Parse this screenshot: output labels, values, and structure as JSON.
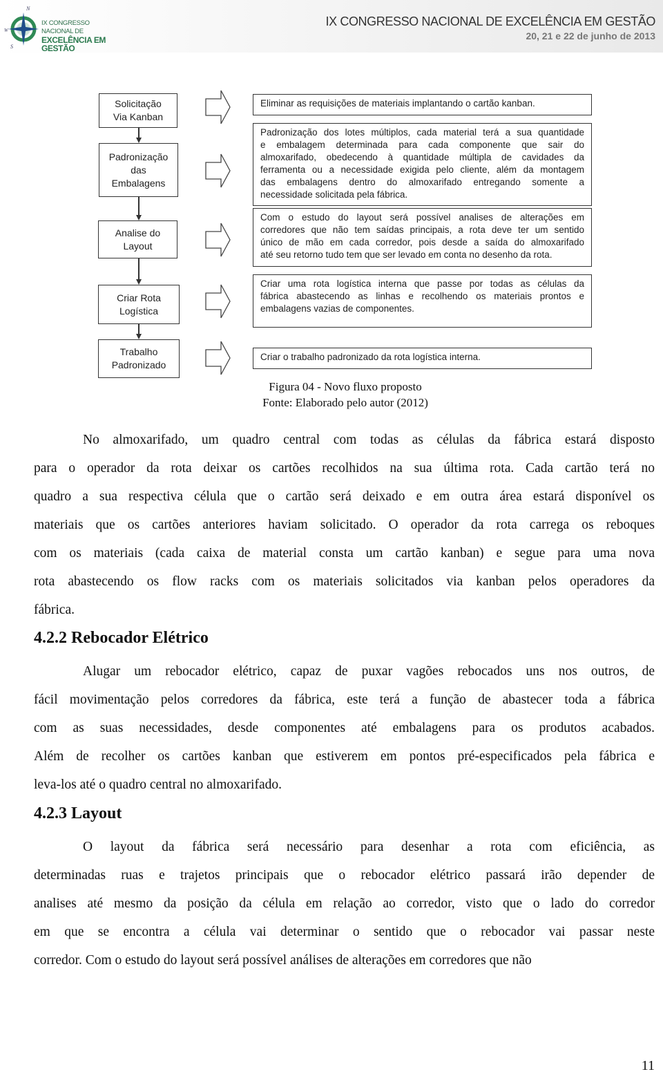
{
  "header": {
    "logo_text_line1": "IX CONGRESSO NACIONAL DE",
    "logo_text_line2": "EXCELÊNCIA EM GESTÃO",
    "title": "IX CONGRESSO NACIONAL DE EXCELÊNCIA EM GESTÃO",
    "date": "20, 21 e 22 de junho de 2013"
  },
  "figure": {
    "steps": [
      {
        "label_lines": [
          "Solicitação",
          "Via Kanban"
        ],
        "description_lines": [
          "Eliminar as requisições de materiais implantando o cartão kanban."
        ]
      },
      {
        "label_lines": [
          "Padronização",
          "das",
          "Embalagens"
        ],
        "description_lines": [
          "Padronização dos lotes múltiplos, cada material terá a sua quantidade",
          "e embalagem determinada para cada componente que sair do",
          "almoxarifado, obedecendo à quantidade múltipla de cavidades da",
          "ferramenta ou a necessidade exigida pelo cliente, além da montagem",
          "das embalagens dentro do almoxarifado entregando somente a",
          "necessidade solicitada pela fábrica."
        ]
      },
      {
        "label_lines": [
          "Analise do",
          "Layout"
        ],
        "description_lines": [
          "Com o estudo do layout será possível analises de alterações em",
          "corredores que não tem saídas principais, a rota deve ter um sentido",
          "único de mão em cada corredor, pois desde a saída do almoxarifado",
          "até seu retorno tudo tem que ser levado em conta no desenho da rota."
        ]
      },
      {
        "label_lines": [
          "Criar Rota",
          "Logística"
        ],
        "description_lines": [
          "Criar uma rota logística interna que passe por todas as células da",
          "fábrica abastecendo as linhas e recolhendo os materiais prontos e",
          "embalagens vazias de componentes."
        ]
      },
      {
        "label_lines": [
          "Trabalho",
          "Padronizado"
        ],
        "description_lines": [
          "Criar o trabalho padronizado da rota logística interna."
        ]
      }
    ],
    "caption": "Figura 04 - Novo fluxo proposto",
    "source": "Fonte: Elaborado pelo autor (2012)"
  },
  "body": {
    "paragraph1": [
      "No almoxarifado, um quadro central com todas as células da fábrica estará disposto",
      "para o operador da rota deixar os cartões recolhidos na sua última rota. Cada cartão terá no",
      "quadro a sua respectiva célula que o cartão será deixado e em outra área estará disponível os",
      "materiais que os cartões anteriores haviam solicitado. O operador da rota carrega os reboques",
      "com os materiais (cada caixa de material consta um cartão kanban) e segue para uma nova",
      "rota abastecendo os flow racks com os materiais solicitados via kanban pelos operadores da",
      "fábrica."
    ],
    "heading1": "4.2.2 Rebocador Elétrico",
    "paragraph2": [
      "Alugar um rebocador elétrico, capaz de puxar vagões rebocados uns nos outros, de",
      "fácil movimentação pelos corredores da fábrica, este terá a função de abastecer toda a fábrica",
      "com as suas necessidades, desde componentes até embalagens para os produtos acabados.",
      "Além de recolher os cartões kanban que estiverem em pontos pré-especificados pela fábrica e",
      "leva-los até o quadro central no almoxarifado."
    ],
    "heading2": "4.2.3 Layout",
    "paragraph3": [
      "O layout da fábrica será necessário para desenhar a rota com eficiência, as",
      "determinadas ruas e trajetos principais que o rebocador elétrico passará irão depender de",
      "analises até mesmo da posição da célula em relação ao corredor, visto que o lado do corredor",
      "em que se encontra a célula vai determinar o sentido que o rebocador vai passar neste",
      "corredor. Com o estudo do layout será possível análises de alterações em corredores que não"
    ]
  },
  "page_number": "11"
}
